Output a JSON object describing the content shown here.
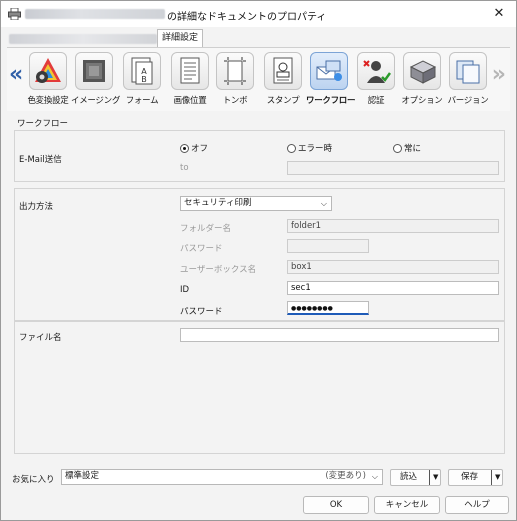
{
  "window": {
    "title": "の詳細なドキュメントのプロパティ",
    "close_glyph": "✕"
  },
  "tabs": {
    "active": "詳細設定"
  },
  "toolbar": {
    "items": [
      {
        "label": "色変換設定",
        "icon": "color-conversion-icon"
      },
      {
        "label": "イメージング",
        "icon": "imaging-icon"
      },
      {
        "label": "フォーム",
        "icon": "form-icon"
      },
      {
        "label": "画像位置",
        "icon": "image-position-icon"
      },
      {
        "label": "トンボ",
        "icon": "crop-marks-icon"
      },
      {
        "label": "スタンプ",
        "icon": "stamp-icon"
      },
      {
        "label": "ワークフロー",
        "icon": "workflow-icon"
      },
      {
        "label": "認証",
        "icon": "authentication-icon"
      },
      {
        "label": "オプション",
        "icon": "option-icon"
      },
      {
        "label": "バージョン",
        "icon": "version-icon"
      }
    ],
    "selected": "ワークフロー"
  },
  "workflow": {
    "heading": "ワークフロー",
    "email_label": "E-Mail送信",
    "radio_off": "オフ",
    "radio_error": "エラー時",
    "radio_always": "常に",
    "to_label": "to"
  },
  "output": {
    "label": "出力方法",
    "method": "セキュリティ印刷",
    "folder_label": "フォルダー名",
    "folder_value": "folder1",
    "password_label": "パスワード",
    "userbox_label": "ユーザーボックス名",
    "userbox_value": "box1",
    "id_label": "ID",
    "id_value": "sec1",
    "secure_password_label": "パスワード",
    "secure_password_value": "●●●●●●●●"
  },
  "filename": {
    "label": "ファイル名",
    "value": ""
  },
  "favorites": {
    "label": "お気に入り",
    "value": "標準設定",
    "modified": "(変更あり)",
    "load": "読込",
    "save": "保存"
  },
  "buttons": {
    "ok": "OK",
    "cancel": "キャンセル",
    "help": "ヘルプ"
  }
}
